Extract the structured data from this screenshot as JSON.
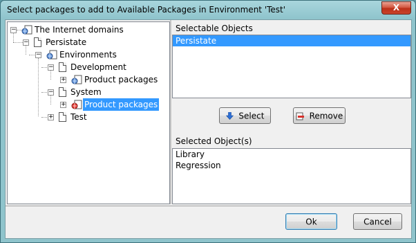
{
  "window": {
    "title": "Select packages to add to Available Packages in Environment 'Test'",
    "close_label": "X"
  },
  "tree": {
    "root": "The Internet domains",
    "persistate": "Persistate",
    "environments": "Environments",
    "development": "Development",
    "dev_product_packages": "Product packages",
    "system": "System",
    "sys_product_packages": "Product packages",
    "test": "Test",
    "expand_symbol": "+",
    "collapse_symbol": "−"
  },
  "selectable": {
    "header": "Selectable Objects",
    "items": [
      "Persistate"
    ]
  },
  "actions": {
    "select_label": "Select",
    "remove_label": "Remove"
  },
  "selected": {
    "header": "Selected Object(s)",
    "items": [
      "Library",
      "Regression"
    ]
  },
  "footer": {
    "ok_label": "Ok",
    "cancel_label": "Cancel"
  },
  "colors": {
    "selection": "#3399ff",
    "frame": "#8fc4cc",
    "close": "#c9452b"
  }
}
